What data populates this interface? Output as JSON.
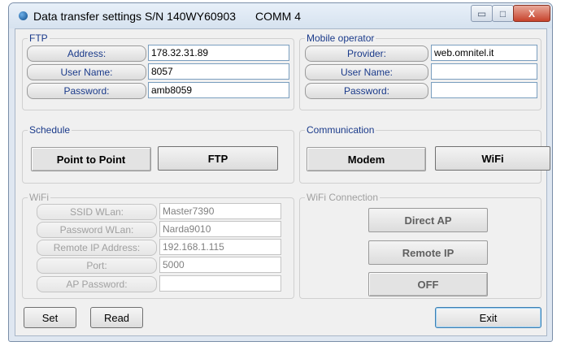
{
  "window": {
    "title": "Data transfer settings S/N 140WY60903",
    "comm": "COMM 4",
    "controls": {
      "minimize": "▭",
      "maximize": "□",
      "close": "X"
    }
  },
  "ftp": {
    "label": "FTP",
    "address_label": "Address:",
    "address": "178.32.31.89",
    "username_label": "User Name:",
    "username": "8057",
    "password_label": "Password:",
    "password": "amb8059"
  },
  "mobile": {
    "label": "Mobile operator",
    "provider_label": "Provider:",
    "provider": "web.omnitel.it",
    "username_label": "User Name:",
    "username": "",
    "password_label": "Password:",
    "password": ""
  },
  "schedule": {
    "label": "Schedule",
    "point_to_point": "Point to Point",
    "ftp": "FTP"
  },
  "communication": {
    "label": "Communication",
    "modem": "Modem",
    "wifi": "WiFi"
  },
  "wifi": {
    "label": "WiFi",
    "ssid_label": "SSID WLan:",
    "ssid": "Master7390",
    "pwd_label": "Password WLan:",
    "pwd": "Narda9010",
    "remote_ip_label": "Remote IP Address:",
    "remote_ip": "192.168.1.115",
    "port_label": "Port:",
    "port": "5000",
    "ap_pwd_label": "AP Password:",
    "ap_pwd": ""
  },
  "wifi_connection": {
    "label": "WiFi Connection",
    "direct_ap": "Direct AP",
    "remote_ip": "Remote IP",
    "off": "OFF"
  },
  "buttons": {
    "set": "Set",
    "read": "Read",
    "exit": "Exit"
  }
}
